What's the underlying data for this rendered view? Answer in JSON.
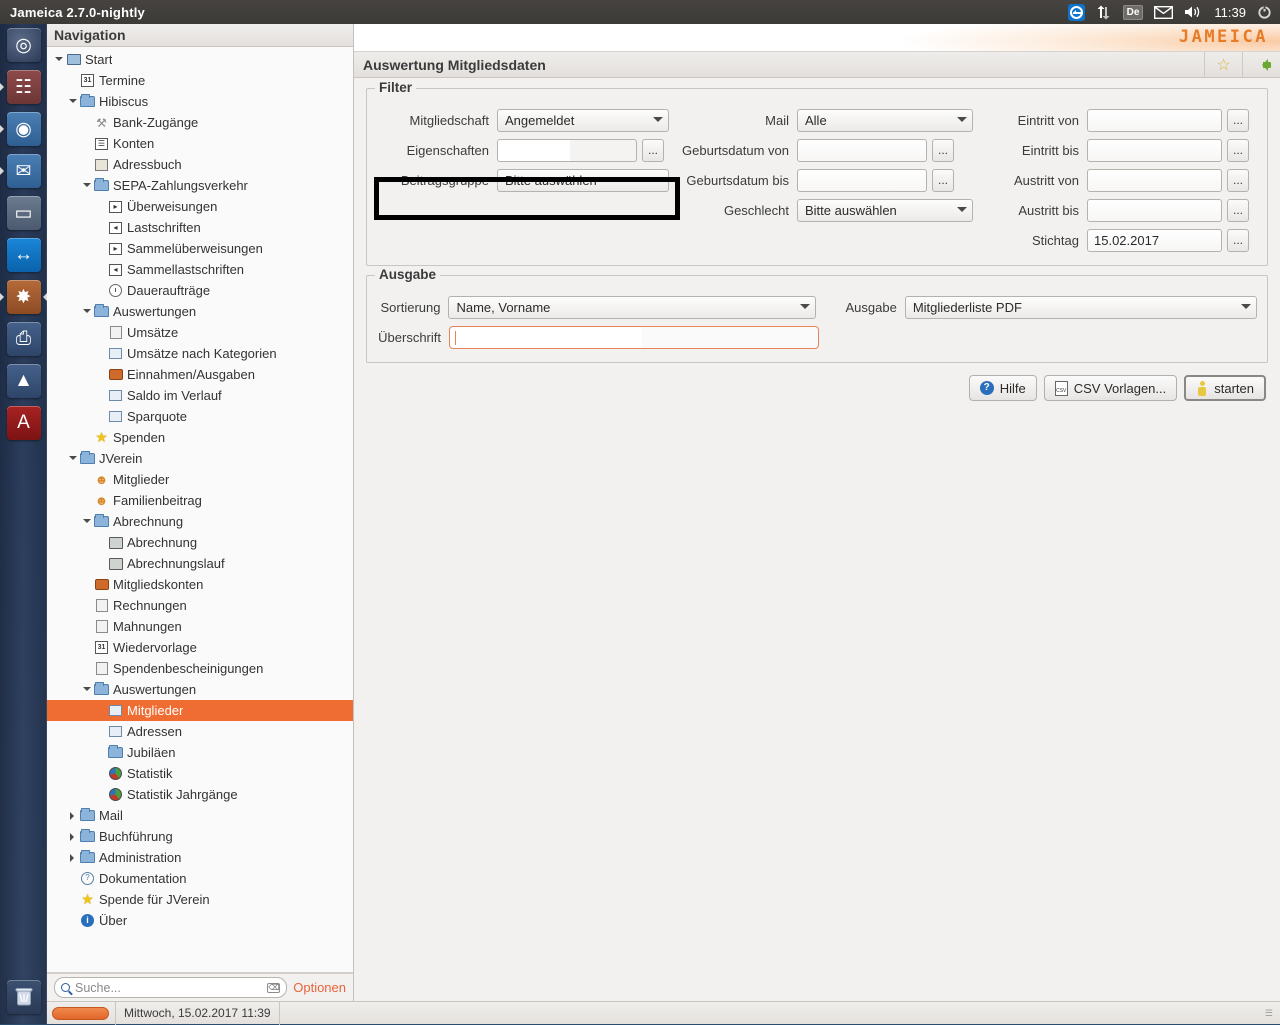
{
  "system_panel": {
    "app_title": "Jameica 2.7.0-nightly",
    "tray": {
      "teamviewer_icon": "teamviewer-icon",
      "network_icon": "network-transfer-icon",
      "keyboard_layout": "De",
      "mail_icon": "mail-icon",
      "volume_icon": "volume-icon",
      "clock": "11:39",
      "power_icon": "power-gear-icon"
    }
  },
  "launcher": {
    "items": [
      {
        "name": "ubuntu-dash",
        "icon": "ubuntu-logo-icon",
        "glyph": "◎",
        "cls": "ico-ubuntu",
        "pip_left": false,
        "pip_right": false
      },
      {
        "name": "files",
        "icon": "file-manager-icon",
        "glyph": "☷",
        "cls": "ico-files",
        "pip_left": true,
        "pip_right": false
      },
      {
        "name": "firefox",
        "icon": "firefox-icon",
        "glyph": "◉",
        "cls": "ico-ff",
        "pip_left": true,
        "pip_right": false
      },
      {
        "name": "thunderbird",
        "icon": "thunderbird-icon",
        "glyph": "✉",
        "cls": "ico-tb",
        "pip_left": true,
        "pip_right": false
      },
      {
        "name": "writer",
        "icon": "document-icon",
        "glyph": "▭",
        "cls": "ico-doc",
        "pip_left": false,
        "pip_right": false
      },
      {
        "name": "teamviewer",
        "icon": "teamviewer-icon",
        "glyph": "↔",
        "cls": "ico-tv",
        "pip_left": false,
        "pip_right": false
      },
      {
        "name": "jameica",
        "icon": "jameica-flower-icon",
        "glyph": "✸",
        "cls": "ico-jam",
        "pip_left": true,
        "pip_right": true
      },
      {
        "name": "printer",
        "icon": "printer-icon",
        "glyph": "⎙",
        "cls": "ico-prn",
        "pip_left": false,
        "pip_right": false
      },
      {
        "name": "vlc",
        "icon": "vlc-cone-icon",
        "glyph": "▲",
        "cls": "ico-vlc",
        "pip_left": false,
        "pip_right": false
      },
      {
        "name": "acrobat",
        "icon": "pdf-reader-icon",
        "glyph": "A",
        "cls": "ico-pdf",
        "pip_left": false,
        "pip_right": false
      }
    ],
    "trash": {
      "name": "trash",
      "icon": "trash-icon",
      "glyph": "🗑"
    }
  },
  "navigation": {
    "header": "Navigation",
    "tree": [
      {
        "label": "Start",
        "depth": 0,
        "twist": "down",
        "icon": "monitor-icon",
        "ic": "i-monitor",
        "sel": false
      },
      {
        "label": "Termine",
        "depth": 1,
        "twist": "",
        "icon": "calendar-icon",
        "ic": "i-cal",
        "glyph": "31",
        "sel": false
      },
      {
        "label": "Hibiscus",
        "depth": 1,
        "twist": "down",
        "icon": "folder-icon",
        "ic": "i-folder",
        "sel": false
      },
      {
        "label": "Bank-Zugänge",
        "depth": 2,
        "twist": "",
        "icon": "key-icon",
        "ic": "i-key",
        "glyph": "⚒",
        "sel": false
      },
      {
        "label": "Konten",
        "depth": 2,
        "twist": "",
        "icon": "accounts-icon",
        "ic": "i-gridbox",
        "glyph": "☰",
        "sel": false
      },
      {
        "label": "Adressbuch",
        "depth": 2,
        "twist": "",
        "icon": "addressbook-icon",
        "ic": "i-addr",
        "sel": false
      },
      {
        "label": "SEPA-Zahlungsverkehr",
        "depth": 2,
        "twist": "down",
        "icon": "folder-icon",
        "ic": "i-folder",
        "sel": false
      },
      {
        "label": "Überweisungen",
        "depth": 3,
        "twist": "",
        "icon": "transfer-out-icon",
        "ic": "i-gridbox",
        "glyph": "▸",
        "sel": false
      },
      {
        "label": "Lastschriften",
        "depth": 3,
        "twist": "",
        "icon": "direct-debit-icon",
        "ic": "i-gridbox",
        "glyph": "◂",
        "sel": false
      },
      {
        "label": "Sammelüberweisungen",
        "depth": 3,
        "twist": "",
        "icon": "batch-transfer-icon",
        "ic": "i-gridbox",
        "glyph": "▸",
        "sel": false
      },
      {
        "label": "Sammellastschriften",
        "depth": 3,
        "twist": "",
        "icon": "batch-debit-icon",
        "ic": "i-gridbox",
        "glyph": "◂",
        "sel": false
      },
      {
        "label": "Daueraufträge",
        "depth": 3,
        "twist": "",
        "icon": "clock-icon",
        "ic": "i-clock",
        "sel": false
      },
      {
        "label": "Auswertungen",
        "depth": 2,
        "twist": "down",
        "icon": "folder-icon",
        "ic": "i-folder",
        "sel": false
      },
      {
        "label": "Umsätze",
        "depth": 3,
        "twist": "",
        "icon": "transactions-icon",
        "ic": "i-lines",
        "sel": false
      },
      {
        "label": "Umsätze nach Kategorien",
        "depth": 3,
        "twist": "",
        "icon": "transactions-by-category-icon",
        "ic": "i-chartsm",
        "sel": false
      },
      {
        "label": "Einnahmen/Ausgaben",
        "depth": 3,
        "twist": "",
        "icon": "income-expense-icon",
        "ic": "i-wallet",
        "sel": false
      },
      {
        "label": "Saldo im Verlauf",
        "depth": 3,
        "twist": "",
        "icon": "balance-trend-icon",
        "ic": "i-chartsm",
        "sel": false
      },
      {
        "label": "Sparquote",
        "depth": 3,
        "twist": "",
        "icon": "savings-rate-icon",
        "ic": "i-chartsm",
        "sel": false
      },
      {
        "label": "Spenden",
        "depth": 2,
        "twist": "",
        "icon": "star-icon",
        "ic": "i-star",
        "glyph": "★",
        "sel": false
      },
      {
        "label": "JVerein",
        "depth": 1,
        "twist": "down",
        "icon": "folder-icon",
        "ic": "i-folder",
        "sel": false
      },
      {
        "label": "Mitglieder",
        "depth": 2,
        "twist": "",
        "icon": "members-icon",
        "ic": "i-people",
        "glyph": "☻",
        "sel": false
      },
      {
        "label": "Familienbeitrag",
        "depth": 2,
        "twist": "",
        "icon": "family-fee-icon",
        "ic": "i-people",
        "glyph": "☻",
        "sel": false
      },
      {
        "label": "Abrechnung",
        "depth": 2,
        "twist": "down",
        "icon": "folder-icon",
        "ic": "i-folder",
        "sel": false
      },
      {
        "label": "Abrechnung",
        "depth": 3,
        "twist": "",
        "icon": "calculator-icon",
        "ic": "i-calc",
        "sel": false
      },
      {
        "label": "Abrechnungslauf",
        "depth": 3,
        "twist": "",
        "icon": "calculator-icon",
        "ic": "i-calc",
        "sel": false
      },
      {
        "label": "Mitgliedskonten",
        "depth": 2,
        "twist": "",
        "icon": "member-accounts-icon",
        "ic": "i-wallet",
        "sel": false
      },
      {
        "label": "Rechnungen",
        "depth": 2,
        "twist": "",
        "icon": "invoices-icon",
        "ic": "i-lines",
        "sel": false
      },
      {
        "label": "Mahnungen",
        "depth": 2,
        "twist": "",
        "icon": "reminders-icon",
        "ic": "i-lines",
        "sel": false
      },
      {
        "label": "Wiedervorlage",
        "depth": 2,
        "twist": "",
        "icon": "calendar-icon",
        "ic": "i-cal",
        "glyph": "31",
        "sel": false
      },
      {
        "label": "Spendenbescheinigungen",
        "depth": 2,
        "twist": "",
        "icon": "donation-receipts-icon",
        "ic": "i-lines",
        "sel": false
      },
      {
        "label": "Auswertungen",
        "depth": 2,
        "twist": "down",
        "icon": "folder-icon",
        "ic": "i-folder",
        "sel": false
      },
      {
        "label": "Mitglieder",
        "depth": 3,
        "twist": "",
        "icon": "members-report-icon",
        "ic": "i-chartsm",
        "sel": true
      },
      {
        "label": "Adressen",
        "depth": 3,
        "twist": "",
        "icon": "addresses-report-icon",
        "ic": "i-chartsm",
        "sel": false
      },
      {
        "label": "Jubiläen",
        "depth": 3,
        "twist": "",
        "icon": "anniversaries-icon",
        "ic": "i-folder",
        "sel": false
      },
      {
        "label": "Statistik",
        "depth": 3,
        "twist": "",
        "icon": "pie-chart-icon",
        "ic": "i-pie",
        "sel": false
      },
      {
        "label": "Statistik Jahrgänge",
        "depth": 3,
        "twist": "",
        "icon": "pie-chart-icon",
        "ic": "i-pie",
        "sel": false
      },
      {
        "label": "Mail",
        "depth": 1,
        "twist": "right",
        "icon": "folder-icon",
        "ic": "i-folder",
        "sel": false
      },
      {
        "label": "Buchführung",
        "depth": 1,
        "twist": "right",
        "icon": "folder-icon",
        "ic": "i-folder",
        "sel": false
      },
      {
        "label": "Administration",
        "depth": 1,
        "twist": "right",
        "icon": "folder-icon",
        "ic": "i-folder",
        "sel": false
      },
      {
        "label": "Dokumentation",
        "depth": 1,
        "twist": "",
        "icon": "documentation-icon",
        "ic": "i-book",
        "glyph": "?",
        "sel": false
      },
      {
        "label": "Spende für JVerein",
        "depth": 1,
        "twist": "",
        "icon": "star-icon",
        "ic": "i-star",
        "glyph": "★",
        "sel": false
      },
      {
        "label": "Über",
        "depth": 1,
        "twist": "",
        "icon": "info-icon",
        "ic": "i-info",
        "glyph": "i",
        "sel": false
      }
    ],
    "search_placeholder": "Suche...",
    "options_label": "Optionen"
  },
  "content": {
    "logo_text": "JAMEICA",
    "view_title": "Auswertung Mitgliedsdaten",
    "bookmark_icon": "star-icon",
    "back_icon": "back-arrow-icon",
    "filter": {
      "title": "Filter",
      "mitgliedschaft_label": "Mitgliedschaft",
      "mitgliedschaft_value": "Angemeldet",
      "eigenschaften_label": "Eigenschaften",
      "eigenschaften_value": "",
      "eigenschaften_browse": "...",
      "beitragsgruppe_label": "Beitragsgruppe",
      "beitragsgruppe_value": "Bitte auswählen",
      "mail_label": "Mail",
      "mail_value": "Alle",
      "geburtsdatum_von_label": "Geburtsdatum von",
      "geburtsdatum_von_value": "",
      "geburtsdatum_bis_label": "Geburtsdatum bis",
      "geburtsdatum_bis_value": "",
      "geschlecht_label": "Geschlecht",
      "geschlecht_value": "Bitte auswählen",
      "eintritt_von_label": "Eintritt von",
      "eintritt_von_value": "",
      "eintritt_bis_label": "Eintritt bis",
      "eintritt_bis_value": "",
      "austritt_von_label": "Austritt von",
      "austritt_von_value": "",
      "austritt_bis_label": "Austritt bis",
      "austritt_bis_value": "",
      "stichtag_label": "Stichtag",
      "stichtag_value": "15.02.2017",
      "browse_label": "..."
    },
    "output": {
      "title": "Ausgabe",
      "sortierung_label": "Sortierung",
      "sortierung_value": "Name, Vorname",
      "ausgabe_label": "Ausgabe",
      "ausgabe_value": "Mitgliederliste PDF",
      "ueberschrift_label": "Überschrift",
      "ueberschrift_value": ""
    },
    "buttons": {
      "help": "Hilfe",
      "csv": "CSV Vorlagen...",
      "start": "starten"
    }
  },
  "statusbar": {
    "date": "Mittwoch, 15.02.2017 11:39"
  }
}
